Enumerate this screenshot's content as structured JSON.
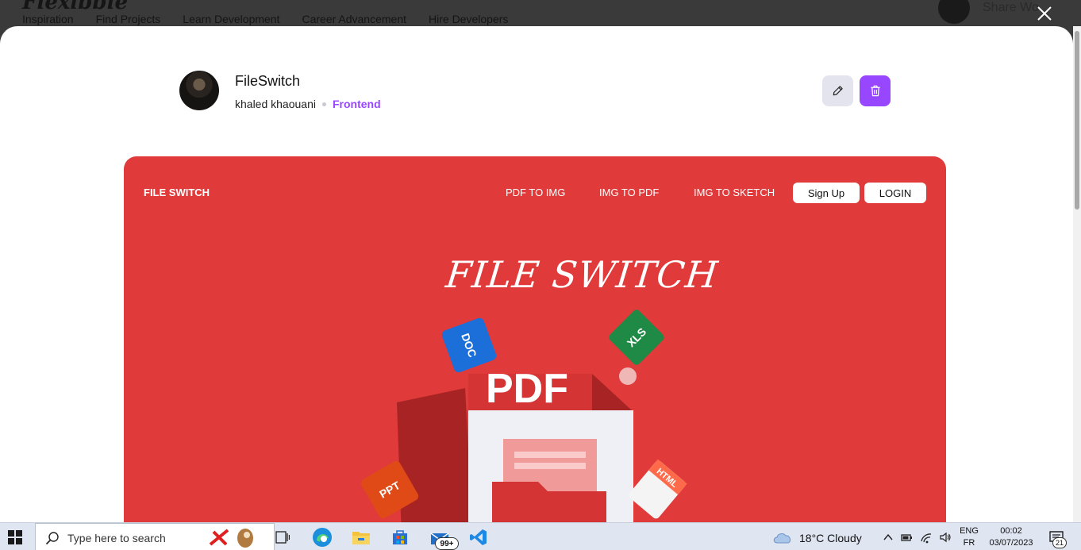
{
  "background_site": {
    "logo": "Flexibble",
    "nav": [
      "Inspiration",
      "Find Projects",
      "Learn Development",
      "Career Advancement",
      "Hire Developers"
    ],
    "share_label": "Share Wo"
  },
  "project": {
    "title": "FileSwitch",
    "author": "khaled khaouani",
    "category": "Frontend"
  },
  "preview": {
    "brand": "FILE SWITCH",
    "links": [
      "PDF TO IMG",
      "IMG TO PDF",
      "IMG TO SKETCH"
    ],
    "signup": "Sign Up",
    "login": "LOGIN",
    "hero_title": "FILE SWITCH",
    "file_labels": {
      "doc": "DOC",
      "xls": "XLS",
      "pdf": "PDF",
      "ppt": "PPT",
      "html": "HTML"
    }
  },
  "taskbar": {
    "search_placeholder": "Type here to search",
    "mail_badge": "99+",
    "weather": "18°C  Cloudy",
    "lang_top": "ENG",
    "lang_bottom": "FR",
    "time": "00:02",
    "date": "03/07/2023",
    "notification_count": "21"
  },
  "colors": {
    "accent": "#9747ff",
    "preview_bg": "#e03a3a",
    "edit_bg": "#e4e4ef"
  }
}
